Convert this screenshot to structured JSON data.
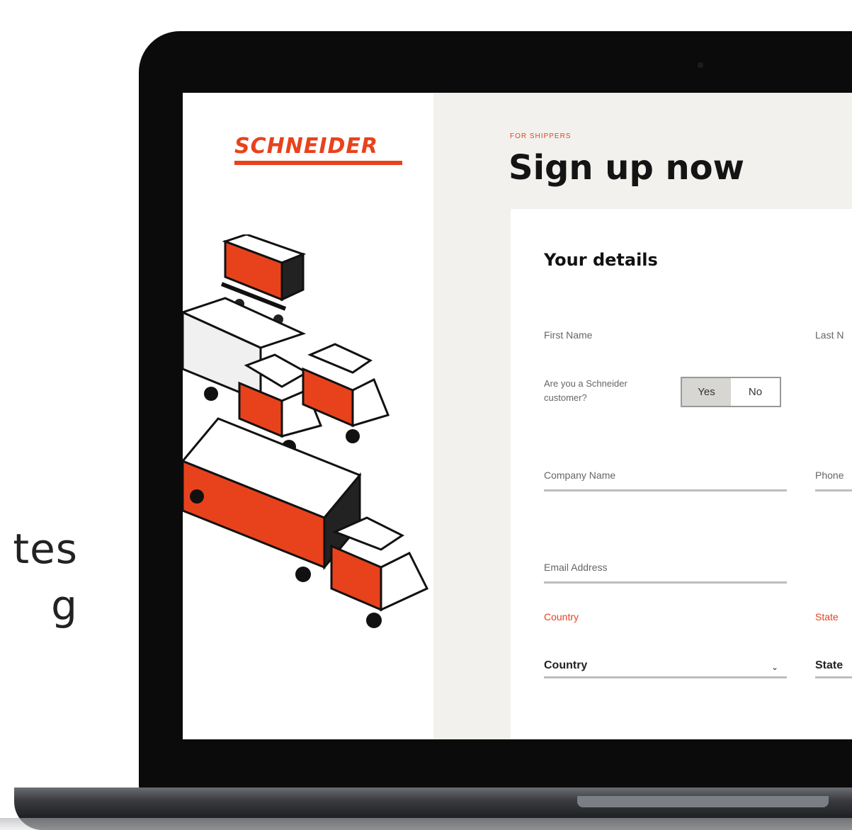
{
  "promo": {
    "line1": "tes",
    "line2": "g"
  },
  "brand": {
    "logo_text": "SCHNEIDER",
    "accent": "#e8421c"
  },
  "header": {
    "eyebrow": "FOR SHIPPERS",
    "title": "Sign up now"
  },
  "form": {
    "section_title": "Your details",
    "first_name_label": "First Name",
    "last_name_label": "Last N",
    "customer_question": "Are you a Schneider customer?",
    "toggle": {
      "yes": "Yes",
      "no": "No",
      "selected": "Yes"
    },
    "company_name_label": "Company Name",
    "phone_label": "Phone",
    "email_label": "Email Address",
    "country_label": "Country",
    "country_value": "Country",
    "state_label": "State",
    "state_value": "State"
  },
  "icons": {
    "chevron": "chevron-down-icon"
  }
}
